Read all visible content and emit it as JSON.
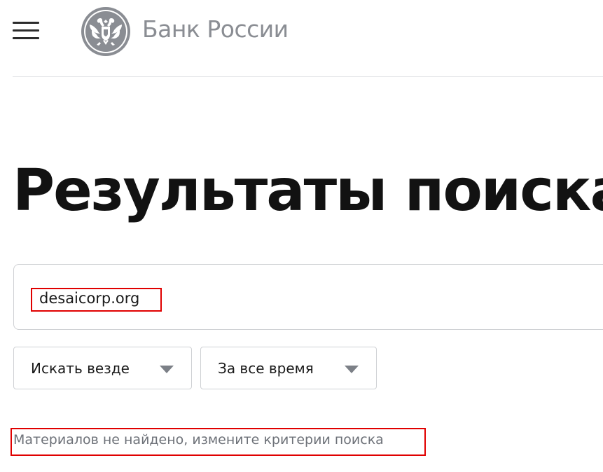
{
  "header": {
    "brand_name": "Банк России",
    "menu_icon": "hamburger-menu-icon",
    "emblem_icon": "double-headed-eagle-emblem",
    "brand_color": "#8a8d93"
  },
  "main": {
    "title": "Результаты поиска",
    "search": {
      "value": "desaicorp.org"
    },
    "filters": {
      "scope_label": "Искать везде",
      "period_label": "За все время",
      "dropdown_icon": "chevron-down-icon"
    },
    "no_results_message": "Материалов не найдено, измените критерии поиска"
  },
  "annotations": {
    "highlight_color": "#e00000"
  }
}
